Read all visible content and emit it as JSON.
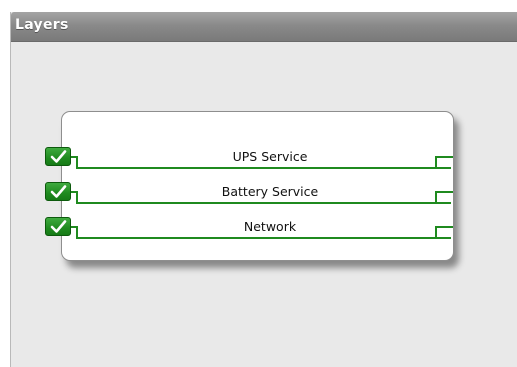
{
  "panel": {
    "title": "Layers"
  },
  "layers": [
    {
      "label": "UPS Service",
      "checked": true
    },
    {
      "label": "Battery Service",
      "checked": true
    },
    {
      "label": "Network",
      "checked": true
    }
  ],
  "colors": {
    "accent_green": "#1f8a1f",
    "header_gray": "#8a8a8a",
    "panel_bg": "#e9e9e9"
  }
}
